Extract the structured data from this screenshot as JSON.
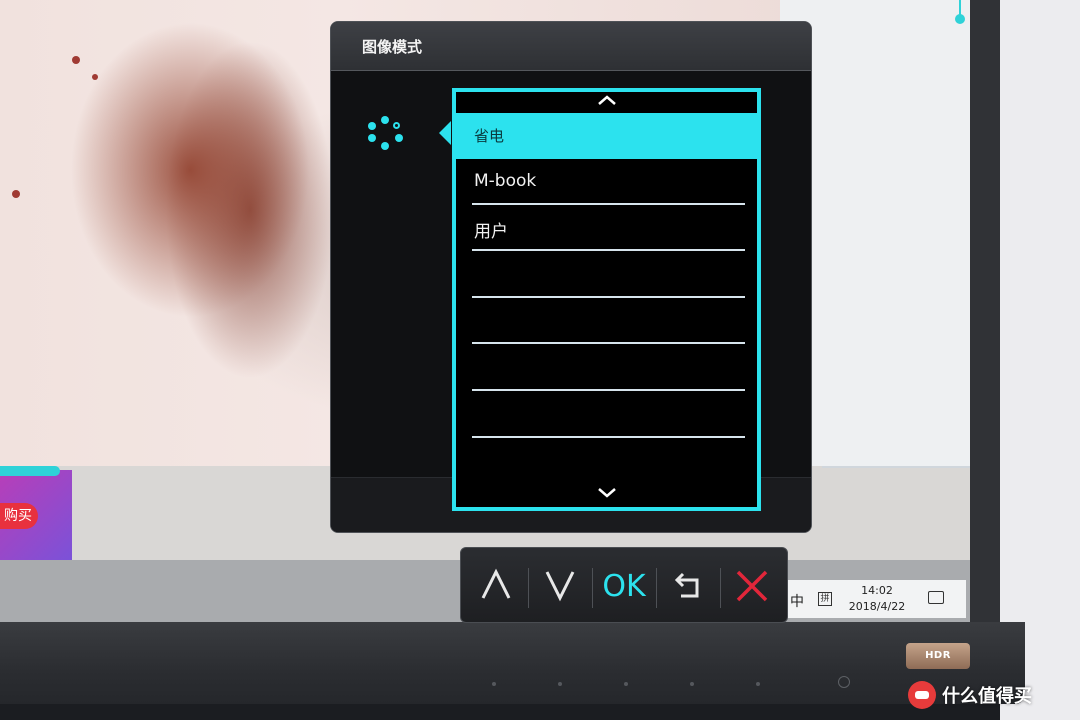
{
  "osd": {
    "title": "图像模式",
    "mode_icon": "color-mode-icon",
    "scroll_up": "^",
    "scroll_down": "v",
    "items": [
      {
        "label": "省电",
        "selected": true
      },
      {
        "label": "M-book",
        "selected": false
      },
      {
        "label": "用户",
        "selected": false
      },
      {
        "label": "",
        "selected": false
      },
      {
        "label": "",
        "selected": false
      },
      {
        "label": "",
        "selected": false
      },
      {
        "label": "",
        "selected": false
      }
    ],
    "accent_color": "#2ce2ee"
  },
  "buttons": {
    "up": "⋀",
    "down": "⋁",
    "ok": "OK",
    "back": "↰",
    "close": "✕",
    "close_color": "#e2263a"
  },
  "taskbar": {
    "ime": "中",
    "time": "14:02",
    "date": "2018/4/22"
  },
  "background": {
    "buy_label": "购买"
  },
  "monitor": {
    "hdr_badge": "HDR",
    "watermark": "什么值得买"
  }
}
